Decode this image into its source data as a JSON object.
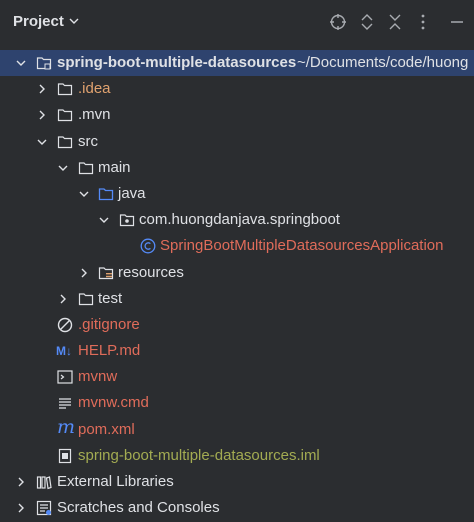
{
  "header": {
    "title": "Project",
    "icons": [
      "target-icon",
      "expand-icon",
      "collapse-icon",
      "more-icon",
      "minimize-icon"
    ]
  },
  "tree": {
    "root": {
      "label": "spring-boot-multiple-datasources",
      "path": "~/Documents/code/huong"
    },
    "idea": ".idea",
    "mvn": ".mvn",
    "src": "src",
    "main": "main",
    "java": "java",
    "package": "com.huongdanjava.springboot",
    "app_class": "SpringBootMultipleDatasourcesApplication",
    "resources": "resources",
    "test": "test",
    "gitignore": ".gitignore",
    "help": "HELP.md",
    "help_badge": "M↓",
    "mvnw": "mvnw",
    "mvnw_cmd": "mvnw.cmd",
    "pom": "pom.xml",
    "pom_badge": "m",
    "iml": "spring-boot-multiple-datasources.iml",
    "ext_libs": "External Libraries",
    "scratches": "Scratches and Consoles"
  },
  "colors": {
    "background": "#2b2d30",
    "selection": "#2e436e",
    "text": "#dfe1e5",
    "unversioned": "#e06c5a",
    "ignored": "#87a96b",
    "class_icon": "#548af7"
  }
}
